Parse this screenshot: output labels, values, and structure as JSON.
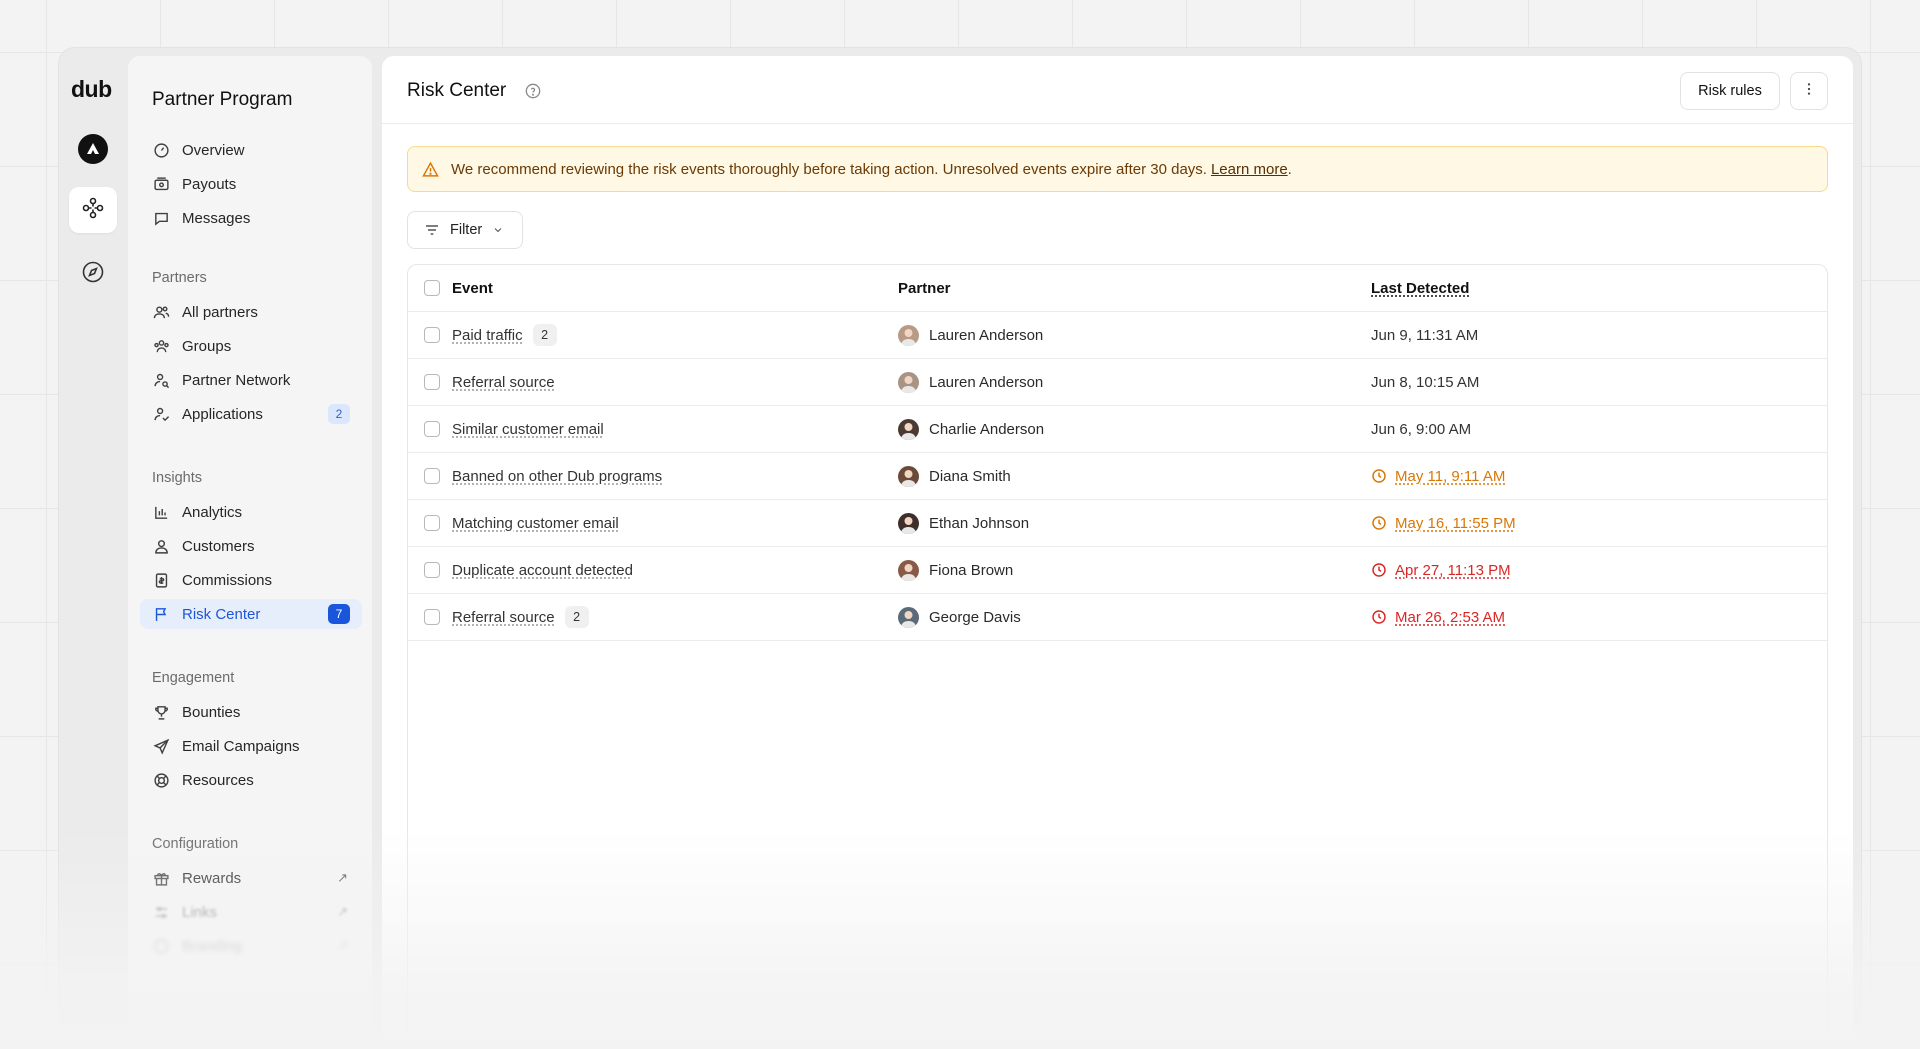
{
  "rail": {
    "logo": "dub",
    "items": [
      {
        "name": "workspace-avatar",
        "icon": "workspace-logo-icon"
      },
      {
        "name": "partner-program",
        "icon": "network-icon"
      },
      {
        "name": "explore",
        "icon": "compass-icon"
      }
    ]
  },
  "sidebar": {
    "title": "Partner Program",
    "top_items": [
      {
        "label": "Overview",
        "icon": "gauge-icon"
      },
      {
        "label": "Payouts",
        "icon": "money-icon"
      },
      {
        "label": "Messages",
        "icon": "chat-icon"
      }
    ],
    "partners_section": "Partners",
    "partners_items": [
      {
        "label": "All partners",
        "icon": "users-icon"
      },
      {
        "label": "Groups",
        "icon": "users-group-icon"
      },
      {
        "label": "Partner Network",
        "icon": "user-search-icon"
      },
      {
        "label": "Applications",
        "icon": "user-check-icon",
        "badge": "2"
      }
    ],
    "insights_section": "Insights",
    "insights_items": [
      {
        "label": "Analytics",
        "icon": "bar-chart-icon"
      },
      {
        "label": "Customers",
        "icon": "user-icon"
      },
      {
        "label": "Commissions",
        "icon": "invoice-icon"
      },
      {
        "label": "Risk Center",
        "icon": "flag-icon",
        "badge": "7"
      }
    ],
    "engagement_section": "Engagement",
    "engagement_items": [
      {
        "label": "Bounties",
        "icon": "trophy-icon"
      },
      {
        "label": "Email Campaigns",
        "icon": "send-icon"
      },
      {
        "label": "Resources",
        "icon": "lifebuoy-icon"
      }
    ],
    "configuration_section": "Configuration",
    "configuration_items": [
      {
        "label": "Rewards",
        "icon": "gift-icon"
      },
      {
        "label": "Links",
        "icon": "sliders-icon"
      },
      {
        "label": "Branding",
        "icon": "palette-icon"
      }
    ]
  },
  "main": {
    "title": "Risk Center",
    "risk_rules_label": "Risk rules",
    "alert_text": "We recommend reviewing the risk events thoroughly before taking action. Unresolved events expire after 30 days.",
    "alert_link": "Learn more",
    "alert_period": ".",
    "filter_label": "Filter",
    "columns": {
      "event": "Event",
      "partner": "Partner",
      "last_detected": "Last Detected"
    },
    "rows": [
      {
        "event": "Paid traffic",
        "count": "2",
        "partner": "Lauren Anderson",
        "date": "Jun 9, 11:31 AM",
        "status": "normal"
      },
      {
        "event": "Referral source",
        "count": "",
        "partner": "Lauren Anderson",
        "date": "Jun 8, 10:15 AM",
        "status": "normal"
      },
      {
        "event": "Similar customer email",
        "count": "",
        "partner": "Charlie Anderson",
        "date": "Jun 6, 9:00 AM",
        "status": "normal"
      },
      {
        "event": "Banned on other Dub programs",
        "count": "",
        "partner": "Diana Smith",
        "date": "May 11, 9:11 AM",
        "status": "warning"
      },
      {
        "event": "Matching customer email",
        "count": "",
        "partner": "Ethan Johnson",
        "date": "May 16, 11:55 PM",
        "status": "warning"
      },
      {
        "event": "Duplicate account detected",
        "count": "",
        "partner": "Fiona Brown",
        "date": "Apr 27, 11:13 PM",
        "status": "danger"
      },
      {
        "event": "Referral source",
        "count": "2",
        "partner": "George Davis",
        "date": "Mar 26, 2:53 AM",
        "status": "danger"
      }
    ]
  },
  "colors": {
    "accent": "#1a56db",
    "warning": "#d97706",
    "danger": "#dc2626",
    "alert_bg": "#fef8e4"
  }
}
